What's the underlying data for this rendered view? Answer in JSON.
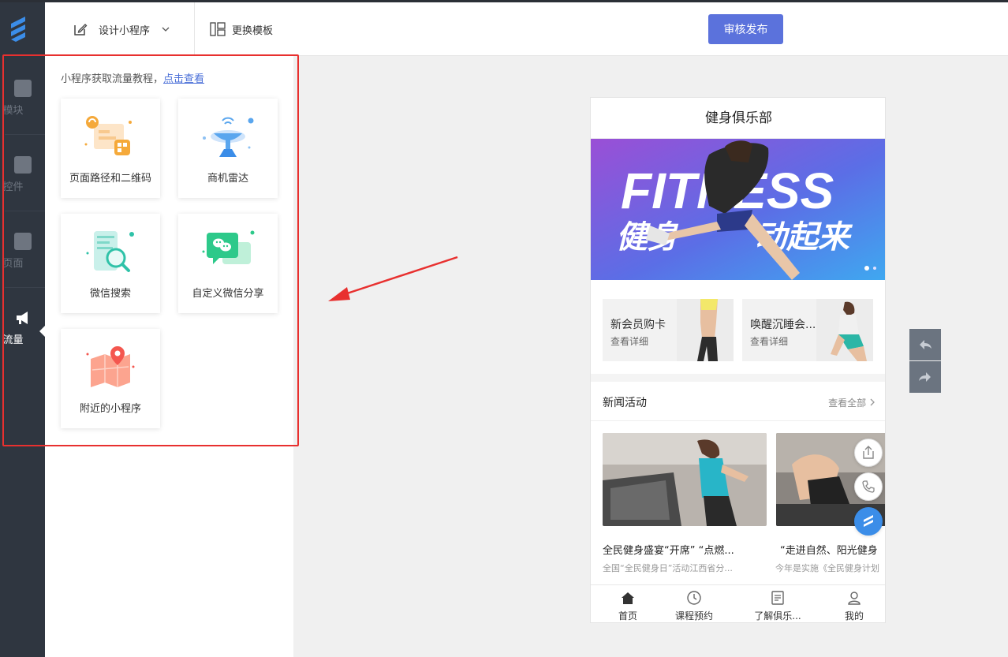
{
  "nav": {
    "items": [
      {
        "label": "模块"
      },
      {
        "label": "控件"
      },
      {
        "label": "页面"
      },
      {
        "label": "流量"
      }
    ]
  },
  "header": {
    "design_label": "设计小程序",
    "template_label": "更换模板",
    "publish_label": "审核发布"
  },
  "panel": {
    "tip_text": "小程序获取流量教程，",
    "tip_link": "点击查看",
    "cards": [
      {
        "label": "页面路径和二维码",
        "icon": "qrcode-path-icon"
      },
      {
        "label": "商机雷达",
        "icon": "radar-icon"
      },
      {
        "label": "微信搜索",
        "icon": "search-phone-icon"
      },
      {
        "label": "自定义微信分享",
        "icon": "wechat-share-icon"
      },
      {
        "label": "附近的小程序",
        "icon": "map-pin-icon"
      }
    ]
  },
  "phone": {
    "title": "健身俱乐部",
    "banner": {
      "big_text": "FITNESS",
      "cn_text_left": "健身",
      "cn_text_right": "动起来"
    },
    "promos": [
      {
        "title": "新会员购卡",
        "sub": "查看详细"
      },
      {
        "title": "唤醒沉睡会...",
        "sub": "查看详细"
      }
    ],
    "news": {
      "title": "新闻活动",
      "more": "查看全部",
      "items": [
        {
          "title": "全民健身盛宴“开席”  “点燃...",
          "sub": "全国“全民健身日”活动江西省分..."
        },
        {
          "title": "“走进自然、阳光健身",
          "sub": "今年是实施《全民健身计划"
        }
      ]
    },
    "tabs": [
      {
        "label": "首页"
      },
      {
        "label": "课程预约"
      },
      {
        "label": "了解俱乐..."
      },
      {
        "label": "我的"
      }
    ]
  },
  "colors": {
    "accent": "#5b72dc",
    "nav_bg": "#2f3640",
    "highlight": "#e8302f",
    "link": "#4a6fd8"
  }
}
